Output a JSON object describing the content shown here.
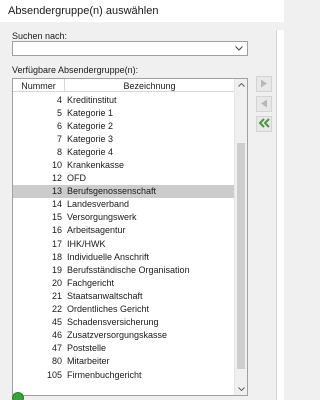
{
  "window": {
    "title": "Absendergruppe(n) auswählen"
  },
  "search": {
    "label": "Suchen nach:",
    "value": "",
    "placeholder": ""
  },
  "list": {
    "label": "Verfügbare Absendergruppe(n):",
    "columns": [
      "Nummer",
      "Bezeichnung"
    ],
    "rows": [
      {
        "num": "4",
        "bez": "Kreditinstitut"
      },
      {
        "num": "5",
        "bez": "Kategorie 1"
      },
      {
        "num": "6",
        "bez": "Kategorie 2"
      },
      {
        "num": "7",
        "bez": "Kategorie 3"
      },
      {
        "num": "8",
        "bez": "Kategorie 4"
      },
      {
        "num": "10",
        "bez": "Krankenkasse"
      },
      {
        "num": "12",
        "bez": "OFD"
      },
      {
        "num": "13",
        "bez": "Berufsgenossenschaft"
      },
      {
        "num": "14",
        "bez": "Landesverband"
      },
      {
        "num": "15",
        "bez": "Versorgungswerk"
      },
      {
        "num": "16",
        "bez": "Arbeitsagentur"
      },
      {
        "num": "17",
        "bez": "IHK/HWK"
      },
      {
        "num": "18",
        "bez": "Individuelle Anschrift"
      },
      {
        "num": "19",
        "bez": "Berufsständische Organisation"
      },
      {
        "num": "20",
        "bez": "Fachgericht"
      },
      {
        "num": "21",
        "bez": "Staatsanwaltschaft"
      },
      {
        "num": "22",
        "bez": "Ordentliches Gericht"
      },
      {
        "num": "45",
        "bez": "Schadensversicherung"
      },
      {
        "num": "46",
        "bez": "Zusatzversorgungskasse"
      },
      {
        "num": "47",
        "bez": "Poststelle"
      },
      {
        "num": "80",
        "bez": "Mitarbeiter"
      },
      {
        "num": "105",
        "bez": "Firmenbuchgericht"
      }
    ],
    "selected_index": 7
  },
  "side_buttons": {
    "add": {
      "icon": "arrow-right-icon"
    },
    "remove": {
      "icon": "arrow-left-icon"
    },
    "remove_all": {
      "icon": "double-arrow-left-icon"
    }
  },
  "colors": {
    "selected_row": "#cccccc",
    "arrow_disabled": "#b8b8b8",
    "arrow_active": "#4a9a3a"
  }
}
